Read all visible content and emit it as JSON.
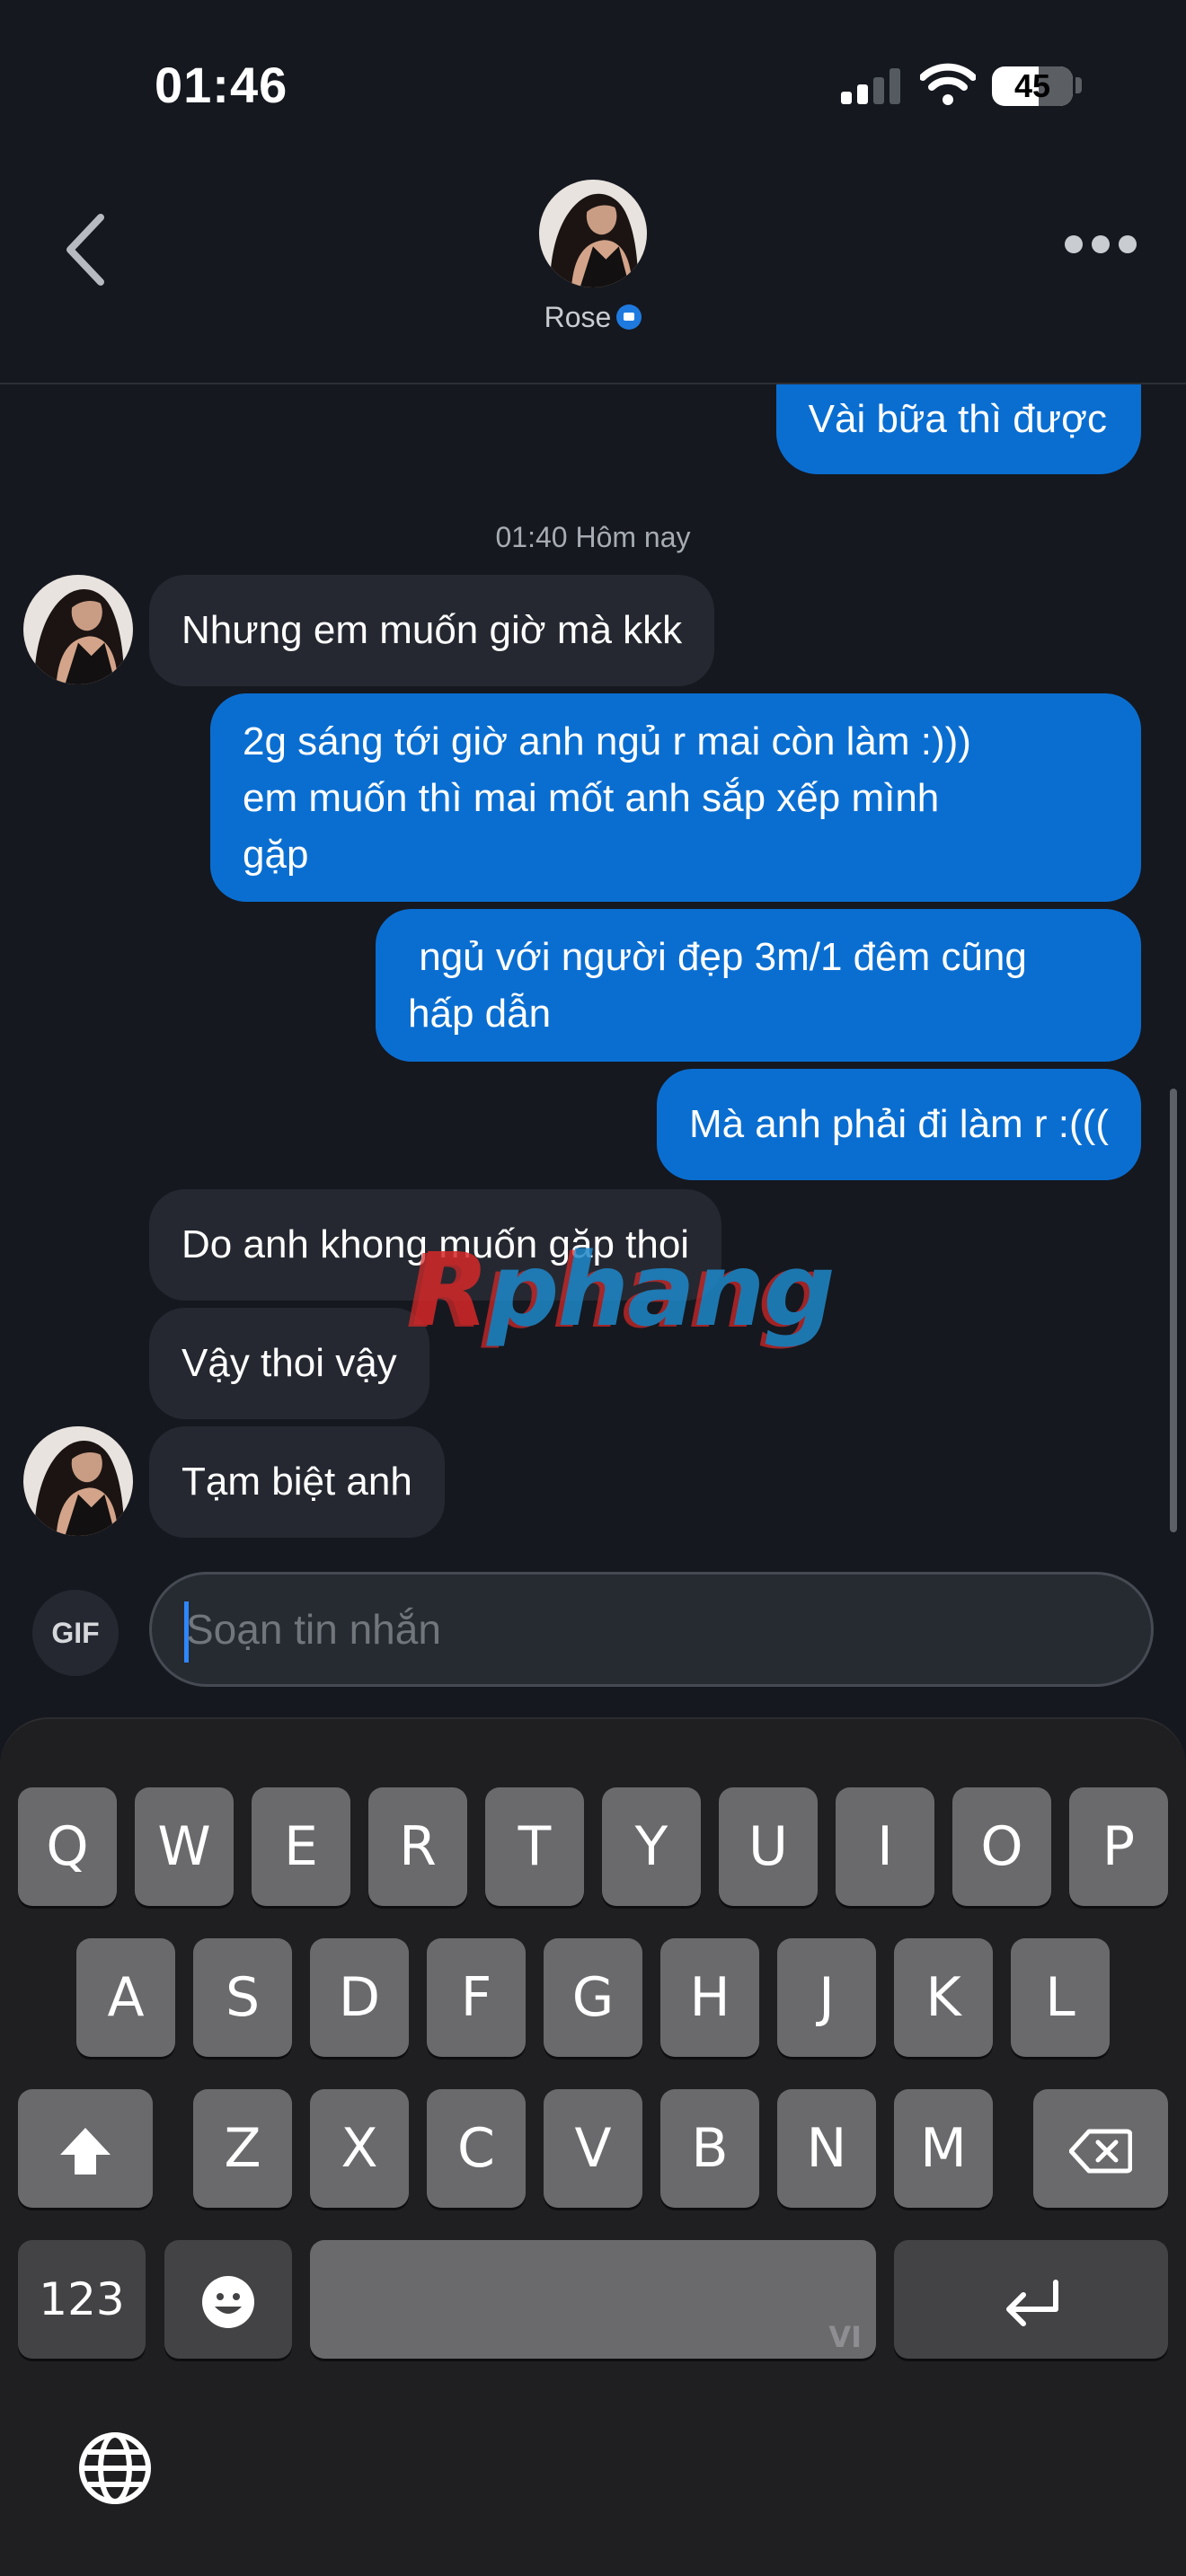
{
  "status_bar": {
    "time": "01:46",
    "battery": "45"
  },
  "header": {
    "contact_name": "Rose"
  },
  "chat": {
    "prev_outgoing": "Vài bữa thì được",
    "timestamp": "01:40 Hôm nay",
    "messages": [
      {
        "direction": "in",
        "text": "Nhưng em muốn giờ mà kkk"
      },
      {
        "direction": "out",
        "lines": [
          "2g sáng tới giờ anh ngủ r mai còn làm :)))",
          "em muốn thì mai mốt anh sắp xếp mình",
          "gặp"
        ]
      },
      {
        "direction": "out",
        "lines": [
          " ngủ với người đẹp 3m/1 đêm cũng",
          "hấp dẫn"
        ]
      },
      {
        "direction": "out",
        "text": "Mà anh phải đi làm r :((("
      },
      {
        "direction": "in",
        "text": "Do anh khong muốn găp thoi"
      },
      {
        "direction": "in",
        "text": "Vậy thoi vậy"
      },
      {
        "direction": "in",
        "text": "Tạm biệt anh"
      }
    ]
  },
  "watermark": {
    "first": "R",
    "rest": "phang"
  },
  "composer": {
    "gif_label": "GIF",
    "placeholder": "Soạn tin nhắn"
  },
  "keyboard": {
    "row1": [
      "Q",
      "W",
      "E",
      "R",
      "T",
      "Y",
      "U",
      "I",
      "O",
      "P"
    ],
    "row2": [
      "A",
      "S",
      "D",
      "F",
      "G",
      "H",
      "J",
      "K",
      "L"
    ],
    "row3": [
      "Z",
      "X",
      "C",
      "V",
      "B",
      "N",
      "M"
    ],
    "numbers_label": "123",
    "space_language": "VI"
  },
  "icons": {
    "back": "chevron-left-icon",
    "more": "more-horizontal-icon",
    "camera": "camera-badge-icon",
    "shift": "shift-icon",
    "delete": "backspace-icon",
    "emoji": "emoji-icon",
    "return": "return-icon",
    "globe": "globe-icon"
  },
  "colors": {
    "outgoing": "#0a6ed1",
    "incoming": "#252830",
    "background": "#15181f",
    "accent": "#2f86ff"
  }
}
